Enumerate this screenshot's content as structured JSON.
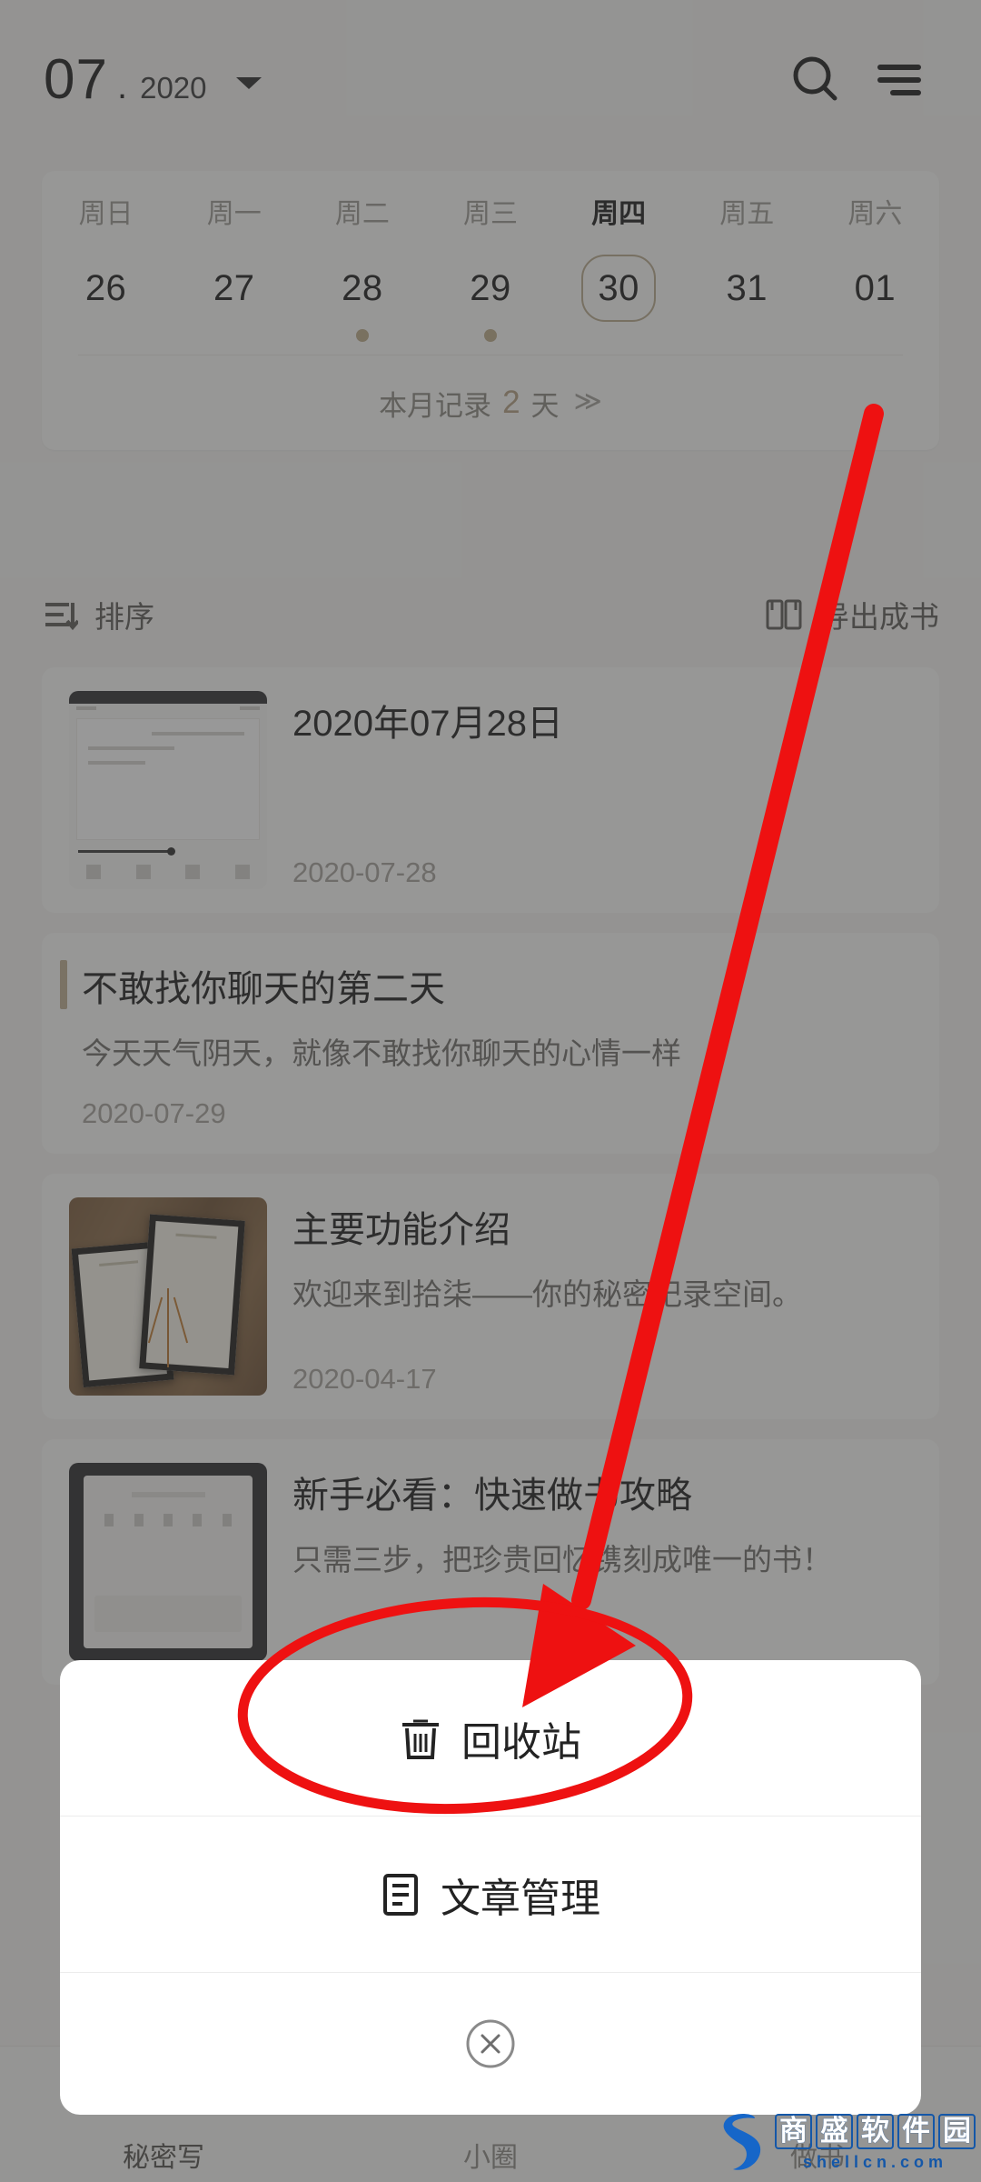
{
  "header": {
    "month": "07",
    "separator": ".",
    "year": "2020",
    "dropdown_icon": "chevron-down-icon",
    "search_icon": "search-icon",
    "menu_icon": "hamburger-menu-icon"
  },
  "calendar": {
    "weekdays": [
      "周日",
      "周一",
      "周二",
      "周三",
      "周四",
      "周五",
      "周六"
    ],
    "active_weekday_index": 4,
    "days": [
      "26",
      "27",
      "28",
      "29",
      "30",
      "31",
      "01"
    ],
    "selected_day_index": 4,
    "dot_day_indexes": [
      2,
      3
    ],
    "summary_prefix": "本月记录",
    "summary_count": "2",
    "summary_suffix": "天",
    "expand_icon": "double-chevron-down-icon",
    "accent_color": "#b9a98c"
  },
  "toolbar": {
    "sort_label": "排序",
    "sort_icon": "sort-icon",
    "export_label": "导出成书",
    "export_icon": "book-icon"
  },
  "list": [
    {
      "title": "2020年07月28日",
      "subtitle": "",
      "date": "2020-07-28",
      "thumb": "screenshot-thumbnail",
      "accent": false
    },
    {
      "title": "不敢找你聊天的第二天",
      "subtitle": "今天天气阴天，就像不敢找你聊天的心情一样",
      "date": "2020-07-29",
      "thumb": "",
      "accent": true
    },
    {
      "title": "主要功能介绍",
      "subtitle": "欢迎来到拾柒——你的秘密记录空间。",
      "date": "2020-04-17",
      "thumb": "photo-thumbnail",
      "accent": false
    },
    {
      "title": "新手必看：快速做书攻略",
      "subtitle": "只需三步，把珍贵回忆镌刻成唯一的书！",
      "date": "",
      "thumb": "phone-thumbnail",
      "accent": false
    }
  ],
  "sheet": {
    "items": [
      {
        "label": "回收站",
        "icon": "trash-icon"
      },
      {
        "label": "文章管理",
        "icon": "document-list-icon"
      }
    ],
    "close_icon": "close-circle-icon"
  },
  "bottom_nav": {
    "items": [
      {
        "label": "秘密写",
        "active": true
      },
      {
        "label": "小圈",
        "active": false
      },
      {
        "label": "做书",
        "active": false
      }
    ]
  },
  "annotation": {
    "color": "#ee1111",
    "arrow_name": "red-arrow-pointing-to-recycle-bin",
    "ellipse_name": "red-ellipse-highlight-recycle-bin"
  },
  "watermark": {
    "brand_chars": [
      "商",
      "盛",
      "软",
      "件",
      "园"
    ],
    "url": "shellcn.com",
    "logo_icon": "s-logo-icon",
    "color": "#1457a8"
  }
}
